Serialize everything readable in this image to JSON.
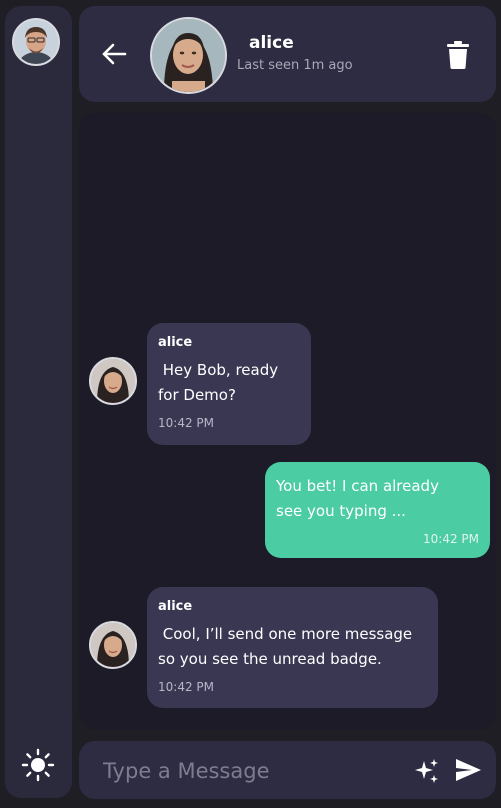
{
  "sidebar": {
    "avatar_icon": "user-avatar",
    "theme_toggle_icon": "sun-icon"
  },
  "header": {
    "back_icon": "arrow-left-icon",
    "contact_name": "alice",
    "last_seen": "Last seen 1m ago",
    "delete_icon": "trash-icon"
  },
  "messages": [
    {
      "direction": "in",
      "sender": "alice",
      "text": " Hey Bob, ready\nfor Demo?",
      "time": "10:42 PM"
    },
    {
      "direction": "out",
      "text": "You bet! I can already\nsee you typing ...",
      "time": "10:42 PM"
    },
    {
      "direction": "in",
      "sender": "alice",
      "text": " Cool, I’ll send one more message\nso you see the unread badge.",
      "time": "10:42 PM"
    }
  ],
  "composer": {
    "placeholder": "Type a Message",
    "sparkle_icon": "sparkle-icon",
    "send_icon": "send-icon"
  },
  "colors": {
    "outgoing_bubble": "#4ccca3",
    "incoming_bubble": "#393752",
    "panel": "#2d2c42",
    "chat_bg": "#1c1b27"
  }
}
